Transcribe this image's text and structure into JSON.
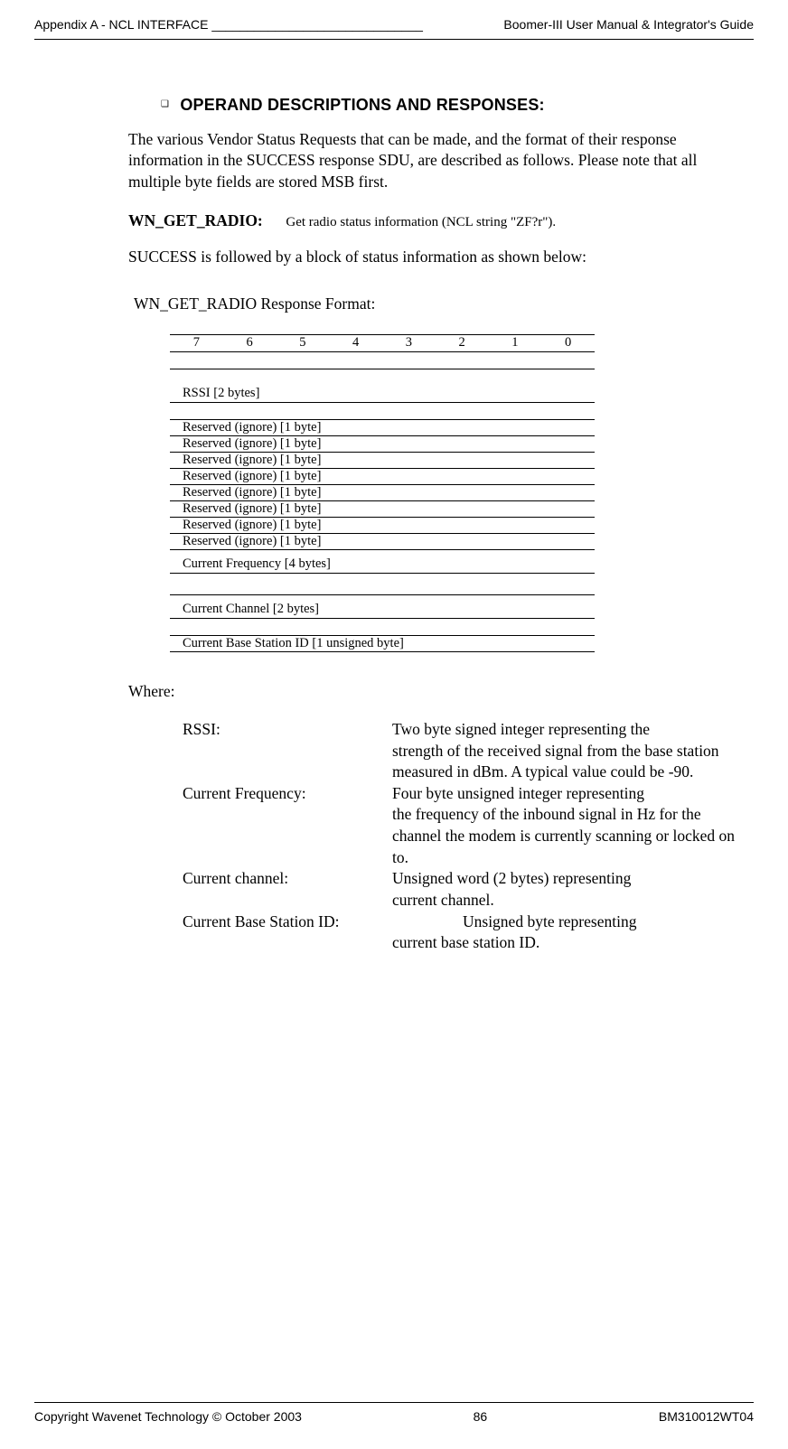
{
  "header": {
    "left": "Appendix A - NCL INTERFACE ______________________________",
    "right": "Boomer-III User Manual & Integrator's Guide"
  },
  "section": {
    "title": "OPERAND DESCRIPTIONS AND RESPONSES:"
  },
  "intro_para": "The various Vendor Status Requests that can be made, and the format of their response information in the SUCCESS response SDU, are described as follows.  Please note that all multiple byte fields are stored MSB first.",
  "wn": {
    "label": "WN_GET_RADIO:",
    "desc": "Get radio status information (NCL string \"ZF?r\")."
  },
  "success_para": "SUCCESS is followed by a block of status information as shown below:",
  "response_title": "WN_GET_RADIO Response Format:",
  "bits": [
    "7",
    "6",
    "5",
    "4",
    "3",
    "2",
    "1",
    "0"
  ],
  "struct": {
    "rssi": "RSSI [2 bytes]",
    "r1": "Reserved (ignore)  [1 byte]",
    "r2": "Reserved (ignore) [1 byte]",
    "r3": "Reserved (ignore) [1 byte]",
    "r4": "Reserved (ignore) [1 byte]",
    "r5": "Reserved (ignore) [1 byte]",
    "r6": "Reserved (ignore) [1 byte]",
    "r7": "Reserved (ignore) [1 byte]",
    "r8": "Reserved (ignore) [1 byte]",
    "cf": "Current Frequency [4 bytes]",
    "cc": "Current Channel [2 bytes]",
    "cb": "Current Base Station ID  [1 unsigned byte]"
  },
  "where_label": "Where:",
  "defs": {
    "rssi_t": "RSSI:",
    "rssi_d1": "Two byte signed integer representing the",
    "rssi_d2": "strength of the received signal from the base station measured in dBm.  A typical value could be -90.",
    "cf_t": "Current Frequency:",
    "cf_d1": "Four byte unsigned integer representing",
    "cf_d2": "the frequency of the inbound signal in Hz for the channel the modem is currently scanning or locked on to.",
    "cc_t": "Current channel:",
    "cc_d1": "Unsigned word (2 bytes) representing",
    "cc_d2": "current  channel.",
    "cb_t": "Current  Base Station ID:",
    "cb_d1": "Unsigned byte representing",
    "cb_d2": "current base station ID."
  },
  "footer": {
    "left": "Copyright Wavenet Technology © October 2003",
    "center": "86",
    "right": "BM310012WT04"
  }
}
